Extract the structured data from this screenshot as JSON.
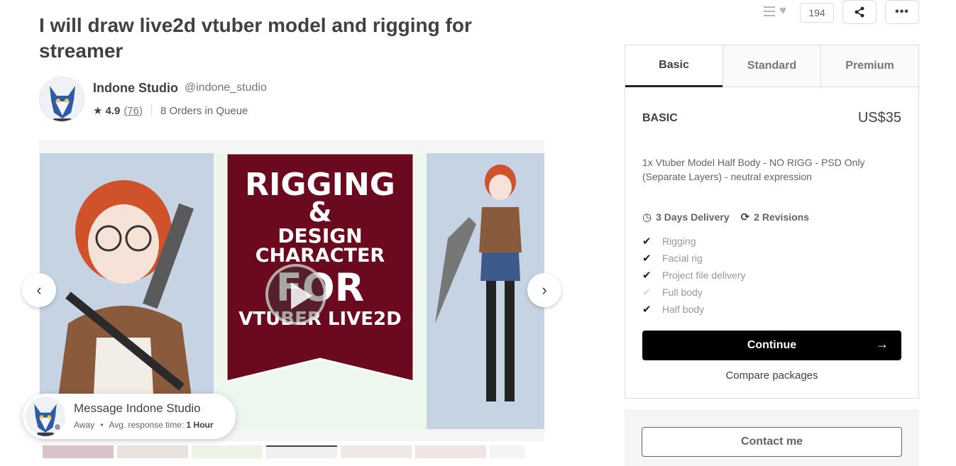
{
  "gig": {
    "title": "I will draw live2d vtuber model and rigging for streamer",
    "banner_lines": [
      "RIGGING",
      "&",
      "DESIGN",
      "CHARACTER",
      "FOR",
      "VTUBER LIVE2D"
    ]
  },
  "seller": {
    "name": "Indone Studio",
    "handle": "@indone_studio",
    "rating": "4.9",
    "review_count": "(76)",
    "orders_in_queue": "8 Orders in Queue"
  },
  "actions": {
    "likes": "194"
  },
  "gallery": {
    "prev_icon": "‹",
    "next_icon": "›"
  },
  "message": {
    "title": "Message Indone Studio",
    "status": "Away",
    "bullet": "•",
    "response_label": "Avg. response time:",
    "response_value": "1 Hour"
  },
  "packages": {
    "tabs": [
      "Basic",
      "Standard",
      "Premium"
    ],
    "selected_tab": "Basic",
    "name": "BASIC",
    "price": "US$35",
    "description": "1x Vtuber Model Half Body - NO RIGG - PSD Only (Separate Layers) - neutral expression",
    "delivery": "3 Days Delivery",
    "revisions": "2 Revisions",
    "features": [
      {
        "label": "Rigging",
        "included": true
      },
      {
        "label": "Facial rig",
        "included": true
      },
      {
        "label": "Project file delivery",
        "included": true
      },
      {
        "label": "Full body",
        "included": false
      },
      {
        "label": "Half body",
        "included": true
      }
    ],
    "continue_label": "Continue",
    "compare_label": "Compare packages"
  },
  "contact": {
    "label": "Contact me"
  },
  "colors": {
    "banner": "#6b0a1f",
    "accent": "#000000",
    "text": "#404145"
  }
}
